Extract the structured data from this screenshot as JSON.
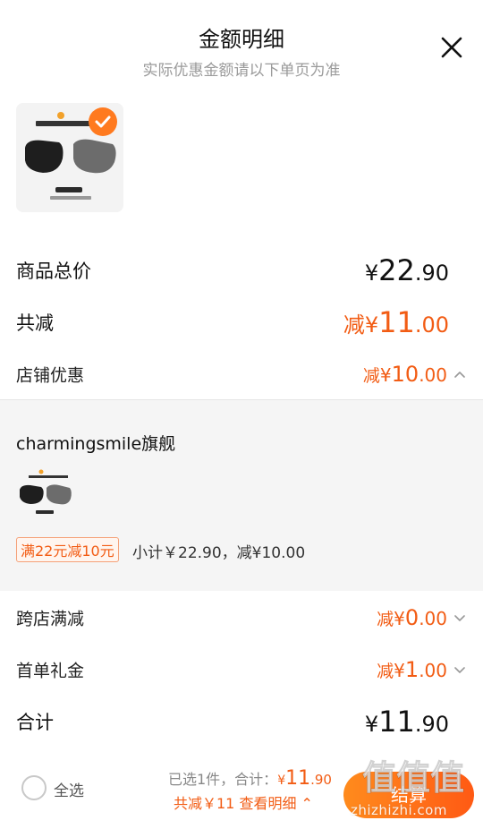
{
  "header": {
    "title": "金额明细",
    "subtitle": "实际优惠金额请以下单页为准"
  },
  "product": {
    "image_icon": "mask-product-image",
    "selected": true
  },
  "summary": {
    "goods_total": {
      "label": "商品总价",
      "yen": "¥",
      "int": "22",
      "dec": ".90"
    },
    "total_reduce": {
      "label": "共减",
      "prefix": "减",
      "yen": "¥",
      "int": "11",
      "dec": ".00"
    },
    "store_discount": {
      "label": "店铺优惠",
      "prefix": "减",
      "yen": "¥",
      "int": "10",
      "dec": ".00",
      "expanded": true
    },
    "cross_store": {
      "label": "跨店满减",
      "prefix": "减",
      "yen": "¥",
      "int": "0",
      "dec": ".00"
    },
    "first_order": {
      "label": "首单礼金",
      "prefix": "减",
      "yen": "¥",
      "int": "1",
      "dec": ".00"
    },
    "total": {
      "label": "合计",
      "yen": "¥",
      "int": "11",
      "dec": ".90"
    }
  },
  "store": {
    "name": "charmingsmile旗舰",
    "promo_tag": "满22元减10元",
    "subtotal": "小计￥22.90，减¥10.00"
  },
  "bottom": {
    "select_all": "全选",
    "selected_count": "已选1件，合计：",
    "selected_total": {
      "yen": "¥",
      "int": "11",
      "dec": ".90"
    },
    "reduce_detail": "共减￥11 查看明细 ⌃",
    "checkout": "结算"
  },
  "watermark": {
    "brand": "值值值",
    "url": "zhizhizhi.com"
  },
  "colors": {
    "accent": "#f25c14",
    "button_start": "#ff8b1d",
    "button_end": "#ff5a14"
  }
}
